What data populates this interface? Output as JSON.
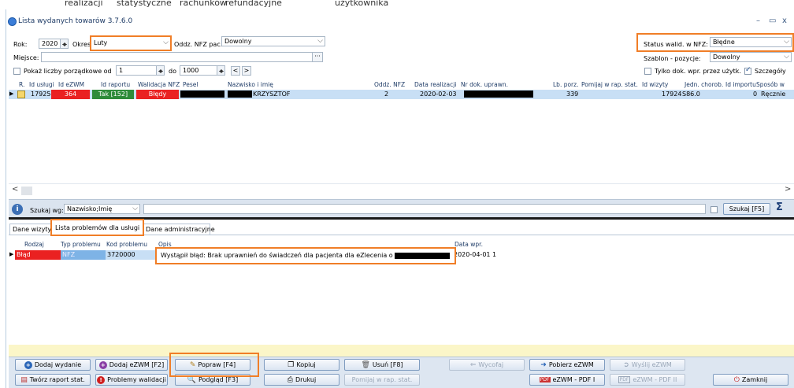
{
  "background_menu": [
    "realizacji",
    "statystyczne",
    "rachunków",
    "refundacyjne",
    "użytkownika"
  ],
  "window": {
    "title": "Lista wydanych towarów 3.7.6.0"
  },
  "filters": {
    "rok_label": "Rok:",
    "rok_value": "2020",
    "okres_label": "Okres",
    "okres_value": "Luty",
    "oddz_label": "Oddz. NFZ pac.:",
    "oddz_value": "Dowolny",
    "status_label": "Status walid. w NFZ:",
    "status_value": "Błędne",
    "miejsce_label": "Miejsce:",
    "miejsce_value": "",
    "szablon_label": "Szablon - pozycje:",
    "szablon_value": "Dowolny",
    "pokaz_label": "Pokaż liczby porządkowe od",
    "pokaz_from": "1",
    "do_label": "do",
    "pokaz_to": "1000",
    "tylko_label": "Tylko dok. wpr. przez użytk.",
    "szczegoly_label": "Szczegóły"
  },
  "grid": {
    "headers": [
      "R.",
      "Id usługi",
      "Id eZWM",
      "Id raportu",
      "Walidacja NFZ",
      "Pesel",
      "Nazwisko i imię",
      "Oddz. NFZ",
      "Data realizacji",
      "Nr dok. uprawn.",
      "Lb. porz.",
      "Pomijaj w rap. stat.",
      "Id wizyty",
      "Jedn. chorob.",
      "Id importu",
      "Sposób w"
    ],
    "row": {
      "id_uslugi": "17925",
      "id_ezwm": "364",
      "id_raportu": "Tak [152]",
      "walidacja": "Błędy",
      "nazwisko": "KRZYSZTOF",
      "oddz": "2",
      "data": "2020-02-03",
      "lb_porz": "339",
      "id_wizyty": "17924",
      "jedn_chorob": "S86.0",
      "id_importu": "0",
      "sposob": "Ręcznie"
    }
  },
  "search": {
    "label": "Szukaj wg:",
    "value": "Nazwisko;Imię",
    "button": "Szukaj [F5]"
  },
  "tabs": [
    "Dane wizyty",
    "Lista problemów dla usługi",
    "Dane administracyjne"
  ],
  "detail": {
    "headers": [
      "Rodzaj",
      "Typ problemu",
      "Kod problemu",
      "Opis",
      "Data wpr."
    ],
    "row": {
      "rodzaj": "Błąd",
      "typ": "NFZ",
      "kod": "3720000",
      "opis": "Wystąpił błąd: Brak uprawnień do świadczeń dla pacjenta dla eZlecenia o id",
      "data": "2020-04-01 1"
    }
  },
  "buttons": {
    "dodaj_wydanie": "Dodaj wydanie",
    "dodaj_ezwm": "Dodaj eZWM [F2]",
    "popraw": "Popraw [F4]",
    "kopiuj": "Kopiuj",
    "usun": "Usuń [F8]",
    "wycofaj": "Wycofaj",
    "pobierz": "Pobierz eZWM",
    "wyslij": "Wyślij eZWM",
    "tworz_raport": "Twórz raport stat.",
    "problemy": "Problemy walidacji",
    "podglad": "Podgląd [F3]",
    "drukuj": "Drukuj",
    "pomijaj": "Pomijaj w rap. stat.",
    "pdf1": "eZWM - PDF I",
    "pdf2": "eZWM - PDF II",
    "zamknij": "Zamknij"
  },
  "colors": {
    "highlight": "#f07e27",
    "error": "#ea2121",
    "ok": "#2e8b3a",
    "selection": "#c8dff5"
  }
}
